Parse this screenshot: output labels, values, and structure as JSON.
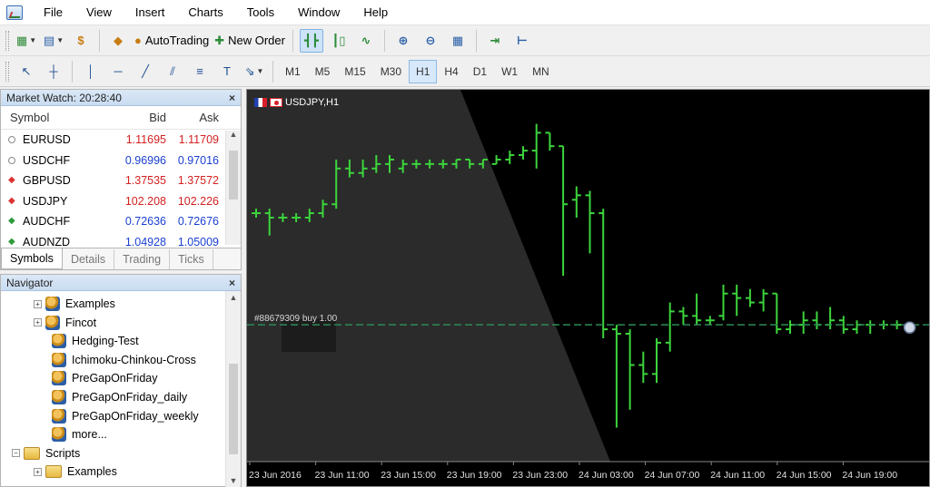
{
  "menu": [
    "File",
    "View",
    "Insert",
    "Charts",
    "Tools",
    "Window",
    "Help"
  ],
  "toolbar": {
    "autotrading_label": "AutoTrading",
    "new_order_label": "New Order",
    "timeframes": [
      "M1",
      "M5",
      "M15",
      "M30",
      "H1",
      "H4",
      "D1",
      "W1",
      "MN"
    ],
    "active_timeframe": "H1"
  },
  "market_watch": {
    "title": "Market Watch: 20:28:40",
    "headers": {
      "symbol": "Symbol",
      "bid": "Bid",
      "ask": "Ask"
    },
    "rows": [
      {
        "symbol": "EURUSD",
        "bid": "1.11695",
        "ask": "1.11709",
        "trend": "neutral",
        "color": "red"
      },
      {
        "symbol": "USDCHF",
        "bid": "0.96996",
        "ask": "0.97016",
        "trend": "neutral",
        "color": "blue"
      },
      {
        "symbol": "GBPUSD",
        "bid": "1.37535",
        "ask": "1.37572",
        "trend": "down",
        "color": "red"
      },
      {
        "symbol": "USDJPY",
        "bid": "102.208",
        "ask": "102.226",
        "trend": "down",
        "color": "red"
      },
      {
        "symbol": "AUDCHF",
        "bid": "0.72636",
        "ask": "0.72676",
        "trend": "up",
        "color": "blue"
      },
      {
        "symbol": "AUDNZD",
        "bid": "1.04928",
        "ask": "1.05009",
        "trend": "up",
        "color": "blue"
      }
    ],
    "tabs": [
      "Symbols",
      "Details",
      "Trading",
      "Ticks"
    ],
    "active_tab": "Symbols"
  },
  "navigator": {
    "title": "Navigator",
    "items": [
      {
        "label": "Examples",
        "type": "ea-folder",
        "indent": 1,
        "expander": "+"
      },
      {
        "label": "Fincot",
        "type": "ea-folder",
        "indent": 1,
        "expander": "+"
      },
      {
        "label": "Hedging-Test",
        "type": "ea",
        "indent": 2
      },
      {
        "label": "Ichimoku-Chinkou-Cross",
        "type": "ea",
        "indent": 2
      },
      {
        "label": "PreGapOnFriday",
        "type": "ea",
        "indent": 2
      },
      {
        "label": "PreGapOnFriday_daily",
        "type": "ea",
        "indent": 2
      },
      {
        "label": "PreGapOnFriday_weekly",
        "type": "ea",
        "indent": 2
      },
      {
        "label": "more...",
        "type": "more",
        "indent": 2
      },
      {
        "label": "Scripts",
        "type": "folder",
        "indent": 0,
        "expander": "-"
      },
      {
        "label": "Examples",
        "type": "script-folder",
        "indent": 1,
        "expander": "+"
      }
    ]
  },
  "chart": {
    "title": "USDJPY,H1",
    "order_line_label": "#88679309 buy 1.00",
    "colors": {
      "background": "#000000",
      "bars": "#3cd43c",
      "order_line": "#2e8b57",
      "axis_text": "#e0e0e0"
    }
  },
  "chart_data": {
    "type": "ohlc",
    "title": "USDJPY,H1",
    "x_ticks": [
      "23 Jun 2016",
      "23 Jun 11:00",
      "23 Jun 15:00",
      "23 Jun 19:00",
      "23 Jun 23:00",
      "24 Jun 03:00",
      "24 Jun 07:00",
      "24 Jun 11:00",
      "24 Jun 15:00",
      "24 Jun 19:00"
    ],
    "ylim": [
      100,
      108
    ],
    "bars": [
      {
        "o": 105.4,
        "h": 105.5,
        "l": 105.3,
        "c": 105.4
      },
      {
        "o": 105.4,
        "h": 105.5,
        "l": 104.9,
        "c": 105.3
      },
      {
        "o": 105.3,
        "h": 105.4,
        "l": 105.2,
        "c": 105.3
      },
      {
        "o": 105.3,
        "h": 105.4,
        "l": 105.2,
        "c": 105.3
      },
      {
        "o": 105.3,
        "h": 105.5,
        "l": 105.2,
        "c": 105.4
      },
      {
        "o": 105.4,
        "h": 105.7,
        "l": 105.3,
        "c": 105.6
      },
      {
        "o": 105.6,
        "h": 106.6,
        "l": 105.5,
        "c": 106.4
      },
      {
        "o": 106.4,
        "h": 106.6,
        "l": 106.2,
        "c": 106.3
      },
      {
        "o": 106.3,
        "h": 106.6,
        "l": 106.2,
        "c": 106.4
      },
      {
        "o": 106.4,
        "h": 106.7,
        "l": 106.3,
        "c": 106.5
      },
      {
        "o": 106.5,
        "h": 106.7,
        "l": 106.3,
        "c": 106.6
      },
      {
        "o": 106.4,
        "h": 106.6,
        "l": 106.3,
        "c": 106.5
      },
      {
        "o": 106.5,
        "h": 106.6,
        "l": 106.4,
        "c": 106.5
      },
      {
        "o": 106.5,
        "h": 106.6,
        "l": 106.4,
        "c": 106.5
      },
      {
        "o": 106.5,
        "h": 106.6,
        "l": 106.4,
        "c": 106.5
      },
      {
        "o": 106.5,
        "h": 106.6,
        "l": 106.4,
        "c": 106.6
      },
      {
        "o": 106.6,
        "h": 106.6,
        "l": 106.4,
        "c": 106.5
      },
      {
        "o": 106.5,
        "h": 106.6,
        "l": 106.4,
        "c": 106.6
      },
      {
        "o": 106.5,
        "h": 106.7,
        "l": 106.5,
        "c": 106.6
      },
      {
        "o": 106.6,
        "h": 106.8,
        "l": 106.5,
        "c": 106.7
      },
      {
        "o": 106.7,
        "h": 106.9,
        "l": 106.6,
        "c": 106.8
      },
      {
        "o": 106.8,
        "h": 107.4,
        "l": 106.4,
        "c": 107.2
      },
      {
        "o": 107.2,
        "h": 107.2,
        "l": 106.8,
        "c": 106.9
      },
      {
        "o": 106.9,
        "h": 106.9,
        "l": 104.0,
        "c": 105.6
      },
      {
        "o": 105.7,
        "h": 106.0,
        "l": 105.3,
        "c": 105.8
      },
      {
        "o": 105.8,
        "h": 105.9,
        "l": 104.5,
        "c": 105.4
      },
      {
        "o": 105.4,
        "h": 105.5,
        "l": 102.6,
        "c": 102.8
      },
      {
        "o": 102.8,
        "h": 102.9,
        "l": 100.6,
        "c": 102.7
      },
      {
        "o": 102.7,
        "h": 102.8,
        "l": 101.0,
        "c": 102.0
      },
      {
        "o": 102.0,
        "h": 102.3,
        "l": 101.6,
        "c": 101.8
      },
      {
        "o": 101.8,
        "h": 102.6,
        "l": 101.6,
        "c": 102.5
      },
      {
        "o": 102.5,
        "h": 103.4,
        "l": 102.3,
        "c": 103.2
      },
      {
        "o": 103.2,
        "h": 103.3,
        "l": 102.9,
        "c": 103.1
      },
      {
        "o": 103.1,
        "h": 103.6,
        "l": 102.9,
        "c": 103.0
      },
      {
        "o": 103.0,
        "h": 103.1,
        "l": 102.9,
        "c": 103.0
      },
      {
        "o": 103.1,
        "h": 103.8,
        "l": 103.0,
        "c": 103.6
      },
      {
        "o": 103.6,
        "h": 103.8,
        "l": 103.1,
        "c": 103.5
      },
      {
        "o": 103.5,
        "h": 103.7,
        "l": 103.3,
        "c": 103.4
      },
      {
        "o": 103.4,
        "h": 103.7,
        "l": 103.2,
        "c": 103.6
      },
      {
        "o": 103.6,
        "h": 103.6,
        "l": 102.7,
        "c": 102.8
      },
      {
        "o": 102.8,
        "h": 103.0,
        "l": 102.7,
        "c": 102.9
      },
      {
        "o": 102.9,
        "h": 103.2,
        "l": 102.7,
        "c": 103.0
      },
      {
        "o": 103.0,
        "h": 103.2,
        "l": 102.8,
        "c": 102.9
      },
      {
        "o": 102.9,
        "h": 103.3,
        "l": 102.8,
        "c": 103.0
      },
      {
        "o": 103.0,
        "h": 103.1,
        "l": 102.7,
        "c": 102.8
      },
      {
        "o": 102.8,
        "h": 103.0,
        "l": 102.7,
        "c": 102.9
      },
      {
        "o": 102.9,
        "h": 103.0,
        "l": 102.7,
        "c": 102.9
      },
      {
        "o": 102.9,
        "h": 103.0,
        "l": 102.8,
        "c": 102.9
      },
      {
        "o": 102.9,
        "h": 103.0,
        "l": 102.8,
        "c": 102.9
      }
    ],
    "order_price": 102.9
  }
}
